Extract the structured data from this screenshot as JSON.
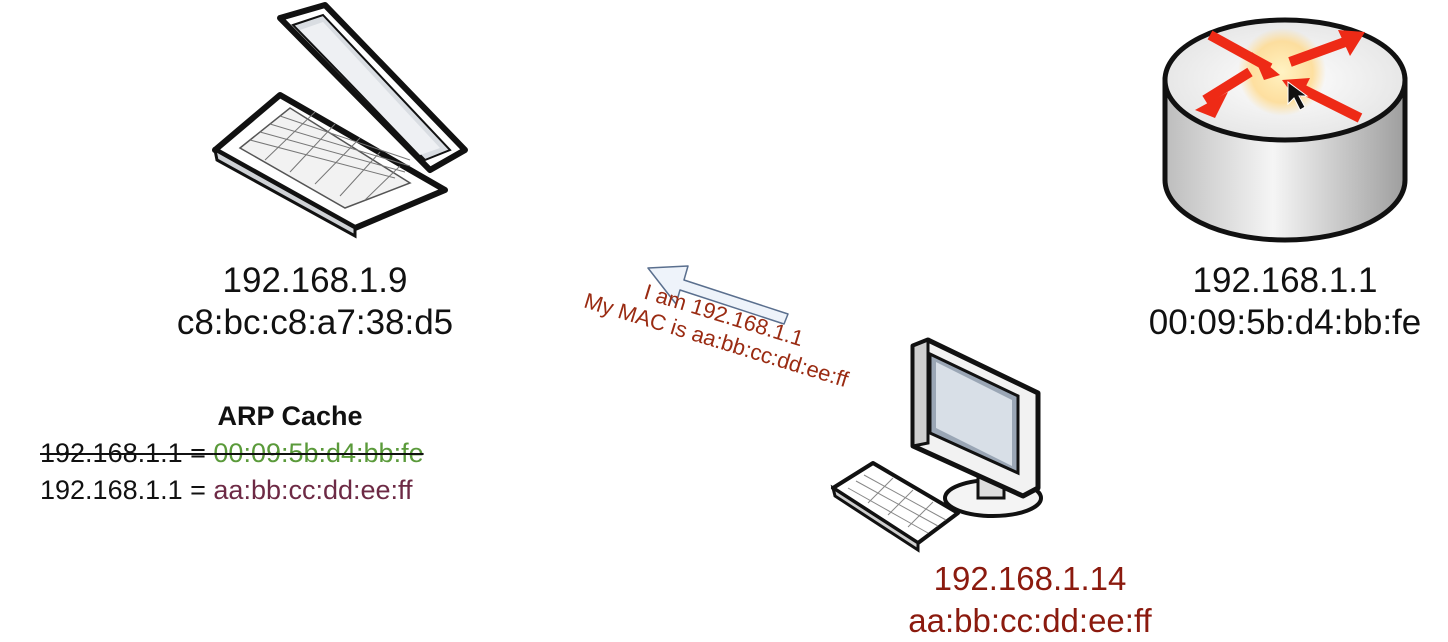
{
  "laptop": {
    "ip": "192.168.1.9",
    "mac": "c8:bc:c8:a7:38:d5",
    "icon": "laptop-icon"
  },
  "router": {
    "ip": "192.168.1.1",
    "mac": "00:09:5b:d4:bb:fe",
    "icon": "router-icon"
  },
  "attacker": {
    "ip": "192.168.1.14",
    "mac": "aa:bb:cc:dd:ee:ff",
    "icon": "desktop-computer-icon"
  },
  "arp_cache": {
    "title": "ARP Cache",
    "old_entry": {
      "ip_part": "192.168.1.1 = ",
      "mac": "00:09:5b:d4:bb:fe"
    },
    "new_entry": {
      "ip_part": "192.168.1.1 = ",
      "mac": "aa:bb:cc:dd:ee:ff"
    }
  },
  "message": {
    "line1": "I am 192.168.1.1",
    "line2": "My MAC is aa:bb:cc:dd:ee:ff"
  },
  "colors": {
    "attacker_text": "#8b1a0e",
    "message_text": "#9a2b12",
    "old_mac": "#5a9a3a",
    "new_mac": "#6d2a45",
    "router_arrows": "#ee2a16"
  }
}
